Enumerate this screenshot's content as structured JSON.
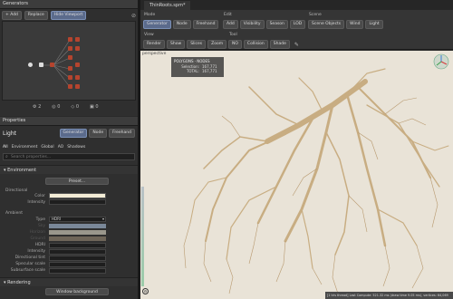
{
  "generator": {
    "panel_title": "Generators",
    "toolbar": {
      "add": "Add",
      "replace": "Replace",
      "hide_all": "Hide Viewport"
    },
    "footer_counts": [
      "2",
      "0",
      "0",
      "0"
    ]
  },
  "properties": {
    "panel_title": "Properties",
    "object_name": "Light",
    "mode_tabs": [
      "Generator",
      "Node",
      "Freehand"
    ],
    "sub_tabs": [
      "All",
      "Environment",
      "Global",
      "AO",
      "Shadows"
    ],
    "search_placeholder": "Search properties...",
    "environment": {
      "title": "Environment",
      "preset_label": "Preset...",
      "directional": {
        "title": "Directional",
        "color_label": "Color",
        "intensity_label": "Intensity",
        "color": "#f3ecd6"
      },
      "ambient": {
        "title": "Ambient",
        "type_label": "Type",
        "type_value": "HDRI",
        "rows": [
          "Sky",
          "Horizon",
          "Ground",
          "HDRI",
          "Intensity",
          "Directional tint",
          "Specular scale",
          "Subsurface scale"
        ]
      }
    },
    "rendering": {
      "title": "Rendering",
      "window_background": "Window background"
    }
  },
  "tab": {
    "title": "ThinRoots.spm*"
  },
  "toolbar": {
    "mode": {
      "label": "Mode",
      "items": [
        "Generator",
        "Node",
        "Freehand"
      ]
    },
    "edit": {
      "label": "Edit",
      "items": [
        "Add",
        "Visibility",
        "Season",
        "LOD"
      ]
    },
    "scene": {
      "label": "Scene",
      "items": [
        "Scene Objects",
        "Wind",
        "Light"
      ]
    },
    "view": {
      "label": "View",
      "items": [
        "Render",
        "Show",
        "Slices",
        "Zoom"
      ]
    },
    "tool": {
      "label": "Tool",
      "items": [
        "NO",
        "Collision",
        "Shade"
      ]
    }
  },
  "viewport": {
    "label": "perspective",
    "stats_title": "POLYGONS · NODES",
    "stats_rows": [
      {
        "label": "Selection:",
        "value": "167,771"
      },
      {
        "label": "TOTAL:",
        "value": "167,771"
      }
    ],
    "status_bar": "[1 tris thread] Last Compute: 521.32 ms (draw time 9.05 ms), vertices: 64,069"
  },
  "colors": {
    "accent": "#5b6b8c",
    "root": "#c8ad82",
    "viewport_bg": "#e9e3d7"
  }
}
